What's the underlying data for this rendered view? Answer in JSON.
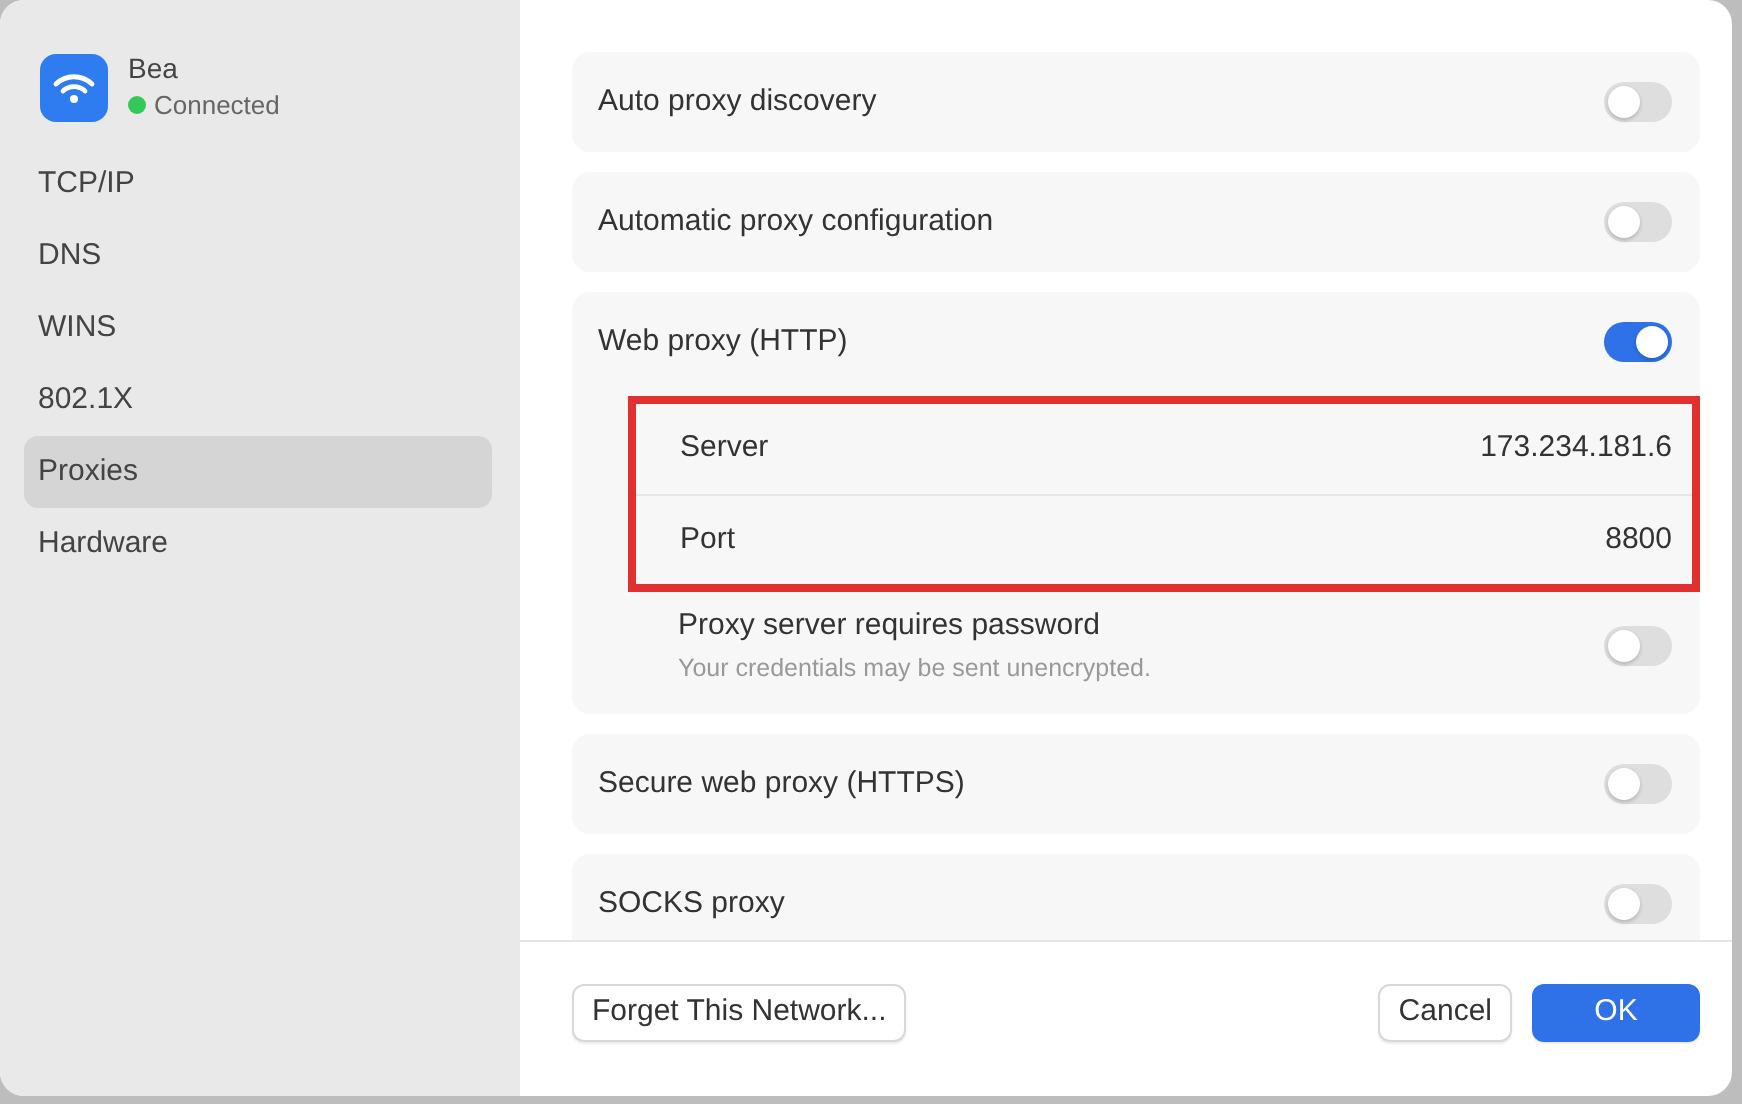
{
  "network": {
    "name": "Bea",
    "status": "Connected",
    "connected": true
  },
  "sidebar": {
    "items": [
      {
        "label": "TCP/IP",
        "selected": false
      },
      {
        "label": "DNS",
        "selected": false
      },
      {
        "label": "WINS",
        "selected": false
      },
      {
        "label": "802.1X",
        "selected": false
      },
      {
        "label": "Proxies",
        "selected": true
      },
      {
        "label": "Hardware",
        "selected": false
      }
    ]
  },
  "proxies": [
    {
      "label": "Auto proxy discovery",
      "on": false
    },
    {
      "label": "Automatic proxy configuration",
      "on": false
    },
    {
      "label": "Web proxy (HTTP)",
      "on": true,
      "fields": {
        "highlighted": true,
        "items": [
          {
            "label": "Server",
            "value": "173.234.181.6"
          },
          {
            "label": "Port",
            "value": "8800"
          }
        ]
      },
      "password": {
        "label": "Proxy server requires password",
        "note": "Your credentials may be sent unencrypted.",
        "on": false
      }
    },
    {
      "label": "Secure web proxy (HTTPS)",
      "on": false
    },
    {
      "label": "SOCKS proxy",
      "on": false
    }
  ],
  "buttons": {
    "forget": "Forget This Network...",
    "cancel": "Cancel",
    "ok": "OK"
  }
}
